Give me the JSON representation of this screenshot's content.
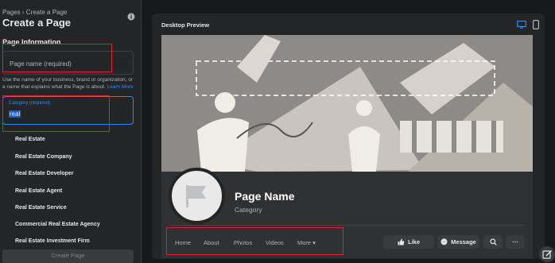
{
  "left": {
    "breadcrumb": "Pages › Create a Page",
    "title": "Create a Page",
    "section_title": "Page Information",
    "name_placeholder": "Page name (required)",
    "hint": "Use the name of your business, brand or organization, or a name that explains what the Page is about.",
    "learn_more": "Learn More",
    "category_label": "Category (required)",
    "category_value": "real",
    "options": [
      "Real Estate",
      "Real Estate Company",
      "Real Estate Developer",
      "Real Estate Agent",
      "Real Estate Service",
      "Commercial Real Estate Agency",
      "Real Estate Investment Firm"
    ],
    "create_button": "Create Page"
  },
  "preview": {
    "title": "Desktop Preview",
    "page_name": "Page Name",
    "category": "Category",
    "tabs": [
      "Home",
      "About",
      "Photos",
      "Videos",
      "More ▾"
    ],
    "like": "Like",
    "message": "Message",
    "more_dots": "···"
  },
  "colors": {
    "accent": "#2d88ff",
    "highlight": "#e0202a",
    "background": "#18191a",
    "panel": "#242526"
  }
}
